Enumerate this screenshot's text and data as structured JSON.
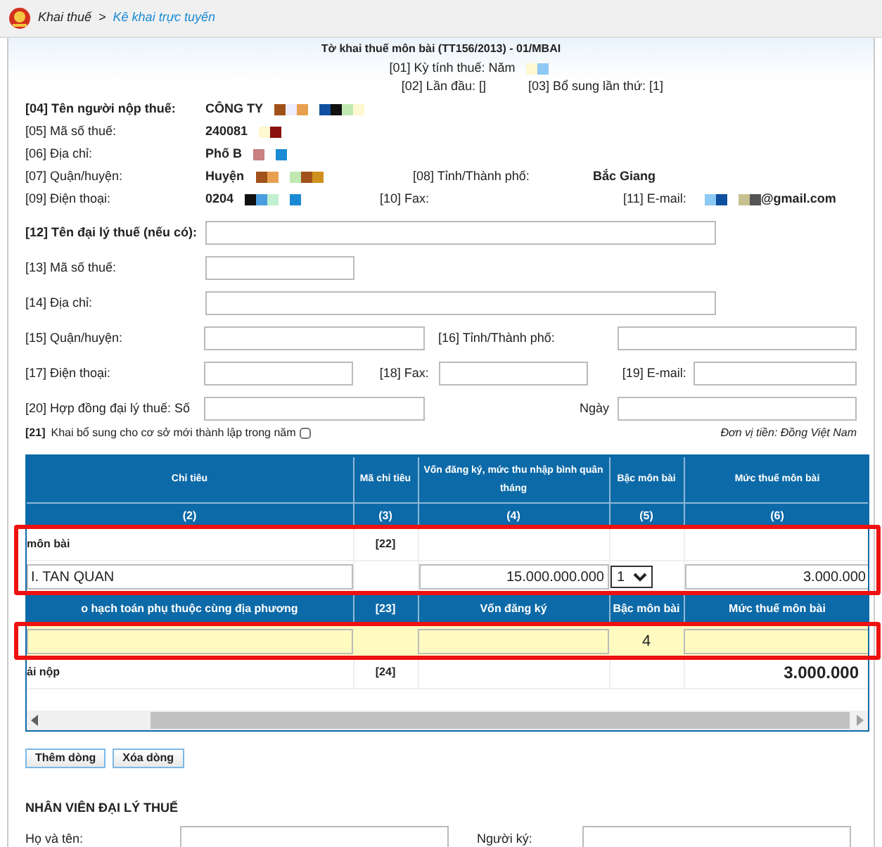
{
  "breadcrumb": {
    "parent": "Khai thuế",
    "separator": ">",
    "current": "Kê khai trực tuyến"
  },
  "form": {
    "title": "Tờ khai thuế môn bài (TT156/2013) - 01/MBAI",
    "period": "[01] Kỳ tính thuế: Năm",
    "first_time": "[02] Lần đầu: []",
    "supplement": "[03] Bổ sung lần thứ: [1]"
  },
  "taxpayer": {
    "name_label": "[04] Tên người nộp thuế:",
    "name": "CÔNG TY",
    "tax_code_label": "[05] Mã số thuế:",
    "tax_code": "240081",
    "address_label": "[06] Địa chỉ:",
    "address": "Phố B",
    "district_label": "[07] Quận/huyện:",
    "district": "Huyện",
    "province_label": "[08] Tỉnh/Thành phố:",
    "province": "Bắc Giang",
    "phone_label": "[09] Điện thoại:",
    "phone": "0204",
    "fax_label": "[10] Fax:",
    "email_label": "[11] E-mail:",
    "email": "@gmail.com"
  },
  "agent": {
    "name_label": "[12] Tên đại lý thuế (nếu có):",
    "tax_code_label": "[13] Mã số thuế:",
    "address_label": "[14] Địa chỉ:",
    "district_label": "[15] Quận/huyện:",
    "province_label": "[16] Tỉnh/Thành phố:",
    "phone_label": "[17] Điện thoại:",
    "fax_label": "[18] Fax:",
    "email_label": "[19] E-mail:",
    "contract_label": "[20] Hợp đồng đại lý thuế: Số",
    "date_label": "Ngày"
  },
  "new_business": {
    "number": "[21]",
    "label": "Khai bổ sung cho cơ sở mới thành lập trong năm",
    "checked": false
  },
  "currency_note": "Đơn vị tiền: Đồng Việt Nam",
  "table": {
    "columns": [
      "Chỉ tiêu",
      "Mã chỉ tiêu",
      "Vốn đăng ký, mức thu nhập bình quân tháng",
      "Bậc môn bài",
      "Mức thuế môn bài"
    ],
    "column_numbers": [
      "(2)",
      "(3)",
      "(4)",
      "(5)",
      "(6)"
    ],
    "rows": [
      {
        "kind": "text",
        "cells": [
          "môn bài",
          "[22]",
          "",
          "",
          ""
        ]
      },
      {
        "kind": "input",
        "cells": [
          "I. TAN QUAN",
          "",
          "15.000.000.000",
          "1",
          "3.000.000"
        ]
      },
      {
        "kind": "header",
        "cells": [
          "o hạch toán phụ thuộc cùng địa phương",
          "[23]",
          "Vốn đăng ký",
          "Bậc môn bài",
          "Mức thuế môn bài"
        ]
      },
      {
        "kind": "yellow",
        "cells": [
          "",
          "",
          "",
          "4",
          ""
        ]
      },
      {
        "kind": "total",
        "cells": [
          "ải nộp",
          "[24]",
          "",
          "",
          "3.000.000"
        ]
      }
    ]
  },
  "buttons": [
    "Thêm dòng",
    "Xóa dòng"
  ],
  "agent_staff": {
    "title": "NHÂN VIÊN ĐẠI LÝ THUẾ",
    "name_label": "Họ và tên:",
    "signer_label": "Người ký:"
  }
}
